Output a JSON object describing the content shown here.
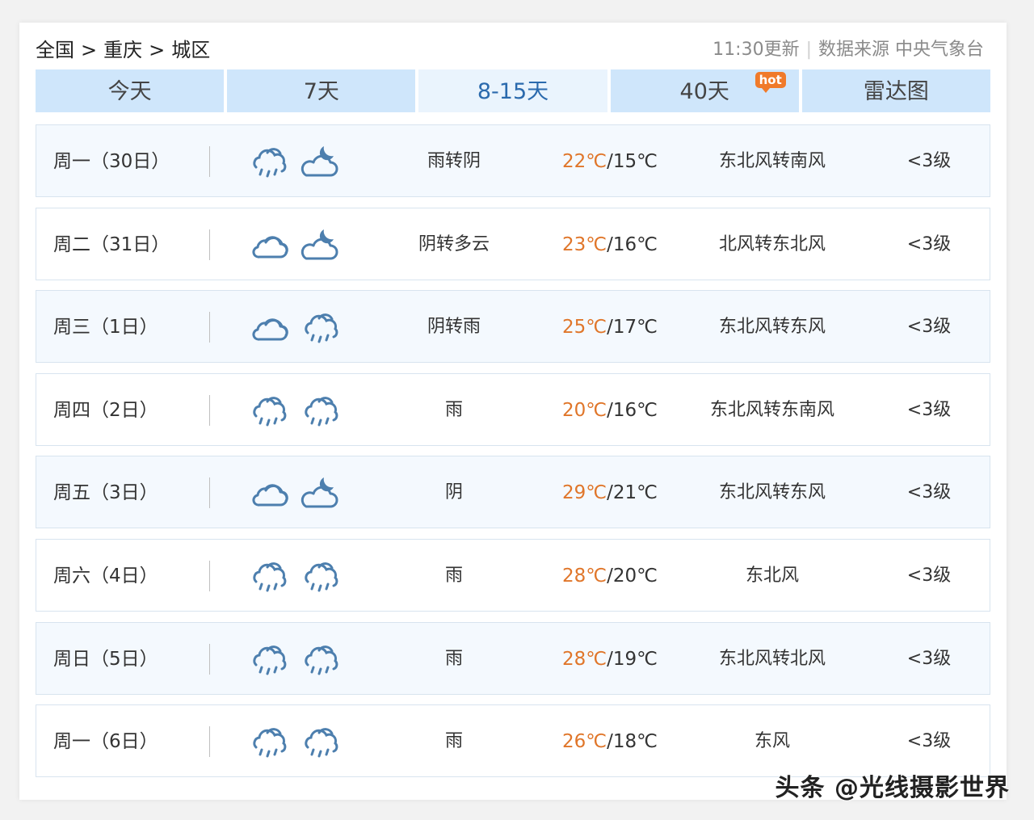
{
  "breadcrumb": {
    "country": "全国",
    "city": "重庆",
    "district": "城区",
    "separator": ">"
  },
  "meta": {
    "update_time": "11:30更新",
    "divider": "|",
    "source": "数据来源 中央气象台"
  },
  "tabs": [
    {
      "label": "今天",
      "active": false
    },
    {
      "label": "7天",
      "active": false
    },
    {
      "label": "8-15天",
      "active": true
    },
    {
      "label": "40天",
      "active": false,
      "badge": "hot"
    },
    {
      "label": "雷达图",
      "active": false
    }
  ],
  "forecast": [
    {
      "day": "周一（30日）",
      "icons": [
        "rain-cloud-icon",
        "cloud-moon-icon"
      ],
      "condition": "雨转阴",
      "high": "22℃",
      "low": "/15℃",
      "wind": "东北风转南风",
      "level": "<3级"
    },
    {
      "day": "周二（31日）",
      "icons": [
        "cloud-icon",
        "cloud-moon-icon"
      ],
      "condition": "阴转多云",
      "high": "23℃",
      "low": "/16℃",
      "wind": "北风转东北风",
      "level": "<3级"
    },
    {
      "day": "周三（1日）",
      "icons": [
        "cloud-icon",
        "rain-cloud-icon"
      ],
      "condition": "阴转雨",
      "high": "25℃",
      "low": "/17℃",
      "wind": "东北风转东风",
      "level": "<3级"
    },
    {
      "day": "周四（2日）",
      "icons": [
        "rain-cloud-icon",
        "rain-cloud-icon"
      ],
      "condition": "雨",
      "high": "20℃",
      "low": "/16℃",
      "wind": "东北风转东南风",
      "level": "<3级"
    },
    {
      "day": "周五（3日）",
      "icons": [
        "cloud-icon",
        "cloud-moon-icon"
      ],
      "condition": "阴",
      "high": "29℃",
      "low": "/21℃",
      "wind": "东北风转东风",
      "level": "<3级"
    },
    {
      "day": "周六（4日）",
      "icons": [
        "rain-cloud-icon",
        "rain-cloud-icon"
      ],
      "condition": "雨",
      "high": "28℃",
      "low": "/20℃",
      "wind": "东北风",
      "level": "<3级"
    },
    {
      "day": "周日（5日）",
      "icons": [
        "rain-cloud-icon",
        "rain-cloud-icon"
      ],
      "condition": "雨",
      "high": "28℃",
      "low": "/19℃",
      "wind": "东北风转北风",
      "level": "<3级"
    },
    {
      "day": "周一（6日）",
      "icons": [
        "rain-cloud-icon",
        "rain-cloud-icon"
      ],
      "condition": "雨",
      "high": "26℃",
      "low": "/18℃",
      "wind": "东风",
      "level": "<3级"
    }
  ],
  "colors": {
    "high_temp": "#e0762a",
    "tab_bg": "#cfe6fb",
    "tab_active_text": "#2b6aad",
    "icon_stroke": "#4d7fae"
  },
  "watermark": "头条 @光线摄影世界"
}
